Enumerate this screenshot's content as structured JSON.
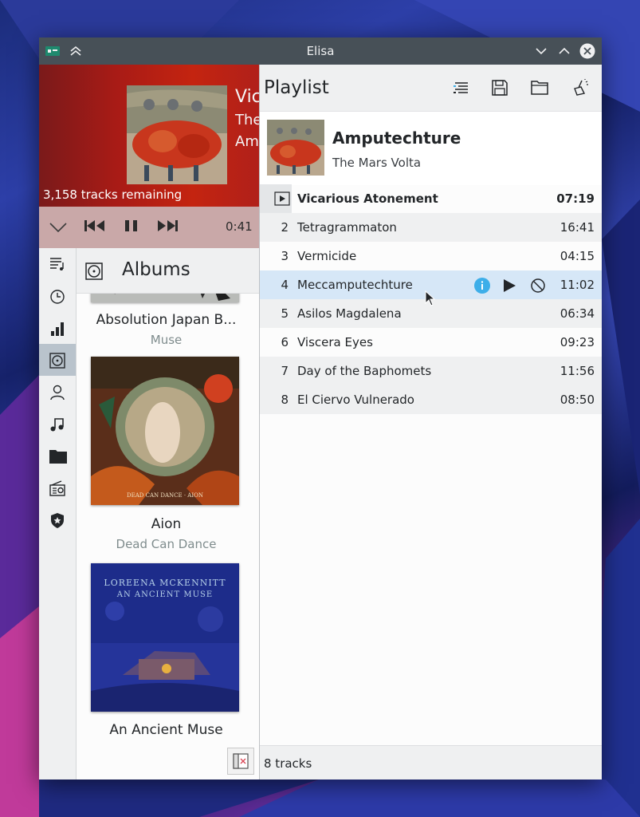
{
  "window": {
    "title": "Elisa"
  },
  "now_playing": {
    "header_lines": [
      "Vic",
      "The",
      "Am"
    ],
    "tracks_remaining": "3,158 tracks remaining",
    "elapsed": "0:41"
  },
  "nav": {
    "items": [
      "playlist-view",
      "recently-played",
      "frequently-played",
      "albums",
      "artists",
      "tracks",
      "files",
      "radios",
      "favorites"
    ],
    "active": "albums"
  },
  "albums": {
    "title": "Albums",
    "list": [
      {
        "name": "Absolution Japan B...",
        "artist": "Muse"
      },
      {
        "name": "Aion",
        "artist": "Dead Can Dance"
      },
      {
        "name": "An Ancient Muse",
        "artist": ""
      }
    ],
    "cover_text": {
      "aion": "DEAD CAN DANCE · AION",
      "muse_line1": "LOREENA MCKENNITT",
      "muse_line2": "AN ANCIENT MUSE"
    }
  },
  "playlist": {
    "title": "Playlist",
    "now_album": "Amputechture",
    "now_artist": "The Mars Volta",
    "tracks": [
      {
        "num": "",
        "name": "Vicarious Atonement",
        "duration": "07:19",
        "current": true
      },
      {
        "num": "2",
        "name": "Tetragrammaton",
        "duration": "16:41"
      },
      {
        "num": "3",
        "name": "Vermicide",
        "duration": "04:15"
      },
      {
        "num": "4",
        "name": "Meccamputechture",
        "duration": "11:02",
        "hover": true
      },
      {
        "num": "5",
        "name": "Asilos Magdalena",
        "duration": "06:34"
      },
      {
        "num": "6",
        "name": "Viscera Eyes",
        "duration": "09:23"
      },
      {
        "num": "7",
        "name": "Day of the Baphomets",
        "duration": "11:56"
      },
      {
        "num": "8",
        "name": "El Ciervo Vulnerado",
        "duration": "08:50"
      }
    ],
    "footer": "8 tracks"
  },
  "colors": {
    "titlebar": "#475057",
    "accent": "#3daee9",
    "header_red": "#a81b16",
    "hover_row": "#d6e7f7"
  }
}
